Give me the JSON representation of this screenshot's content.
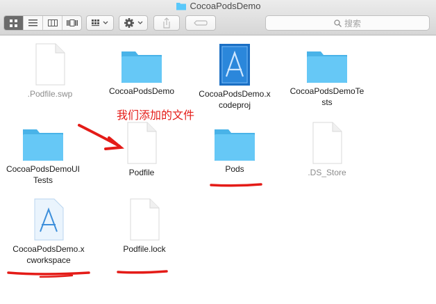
{
  "window": {
    "title": "CocoaPodsDemo"
  },
  "search": {
    "placeholder": "搜索"
  },
  "files": [
    {
      "name": ".Podfile.swp",
      "kind": "document",
      "hidden": true
    },
    {
      "name": "CocoaPodsDemo",
      "kind": "folder"
    },
    {
      "name": "CocoaPodsDemo.x\ncodeproj",
      "kind": "xcodeproj"
    },
    {
      "name": "CocoaPodsDemoTe\nsts",
      "kind": "folder"
    },
    {
      "name": "CocoaPodsDemoUI\nTests",
      "kind": "folder"
    },
    {
      "name": "Podfile",
      "kind": "document"
    },
    {
      "name": "Pods",
      "kind": "folder"
    },
    {
      "name": ".DS_Store",
      "kind": "document",
      "hidden": true
    },
    {
      "name": "CocoaPodsDemo.x\ncworkspace",
      "kind": "xcworkspace"
    },
    {
      "name": "Podfile.lock",
      "kind": "document"
    }
  ],
  "annotation": {
    "text": "我们添加的文件",
    "color": "#e41b17"
  },
  "colors": {
    "folder": "#5ac8fa",
    "annotation": "#e41b17"
  },
  "icons": [
    "icon-view-icon",
    "list-view-icon",
    "column-view-icon",
    "cover-flow-icon",
    "arrange-icon",
    "gear-icon",
    "share-icon",
    "tag-icon",
    "search-icon"
  ]
}
